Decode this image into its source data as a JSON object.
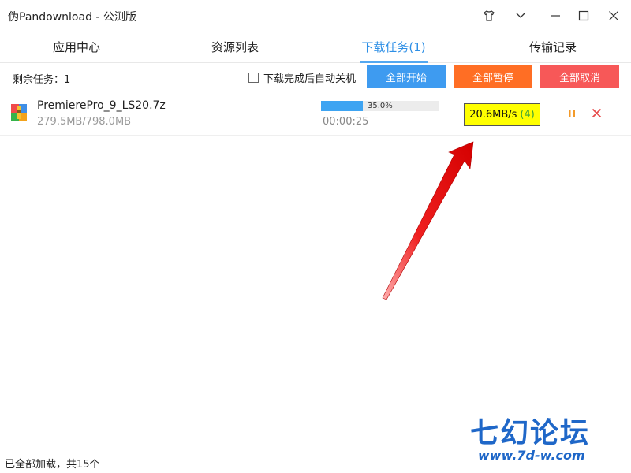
{
  "window": {
    "title": "伪Pandownload - 公测版",
    "controls": [
      "shirt-icon",
      "chevron-down-icon",
      "minimize-icon",
      "maximize-icon",
      "close-icon"
    ]
  },
  "tabs": [
    {
      "label": "应用中心",
      "active": false
    },
    {
      "label": "资源列表",
      "active": false
    },
    {
      "label": "下载任务(1)",
      "active": true
    },
    {
      "label": "传输记录",
      "active": false
    }
  ],
  "toolbar": {
    "remaining_label": "剩余任务：1",
    "auto_shutdown_label": "下载完成后自动关机",
    "auto_shutdown_checked": false,
    "start_all_label": "全部开始",
    "pause_all_label": "全部暂停",
    "cancel_all_label": "全部取消"
  },
  "task": {
    "filename": "PremierePro_9_LS20.7z",
    "size": "279.5MB/798.0MB",
    "progress_text": "35.0%",
    "progress": 0.35,
    "elapsed": "00:00:25",
    "speed": "20.6MB/s",
    "threads": "(4)"
  },
  "status": {
    "text": "已全部加载，共15个"
  },
  "watermark": {
    "title": "七幻论坛",
    "url": "www.7d-w.com"
  },
  "colors": {
    "accent": "#2e8fe6",
    "start_button": "#3e9bf0",
    "pause_button": "#ff6e24",
    "cancel_button": "#f75858",
    "highlight": "#ffff00",
    "arrow": "#e81010"
  }
}
